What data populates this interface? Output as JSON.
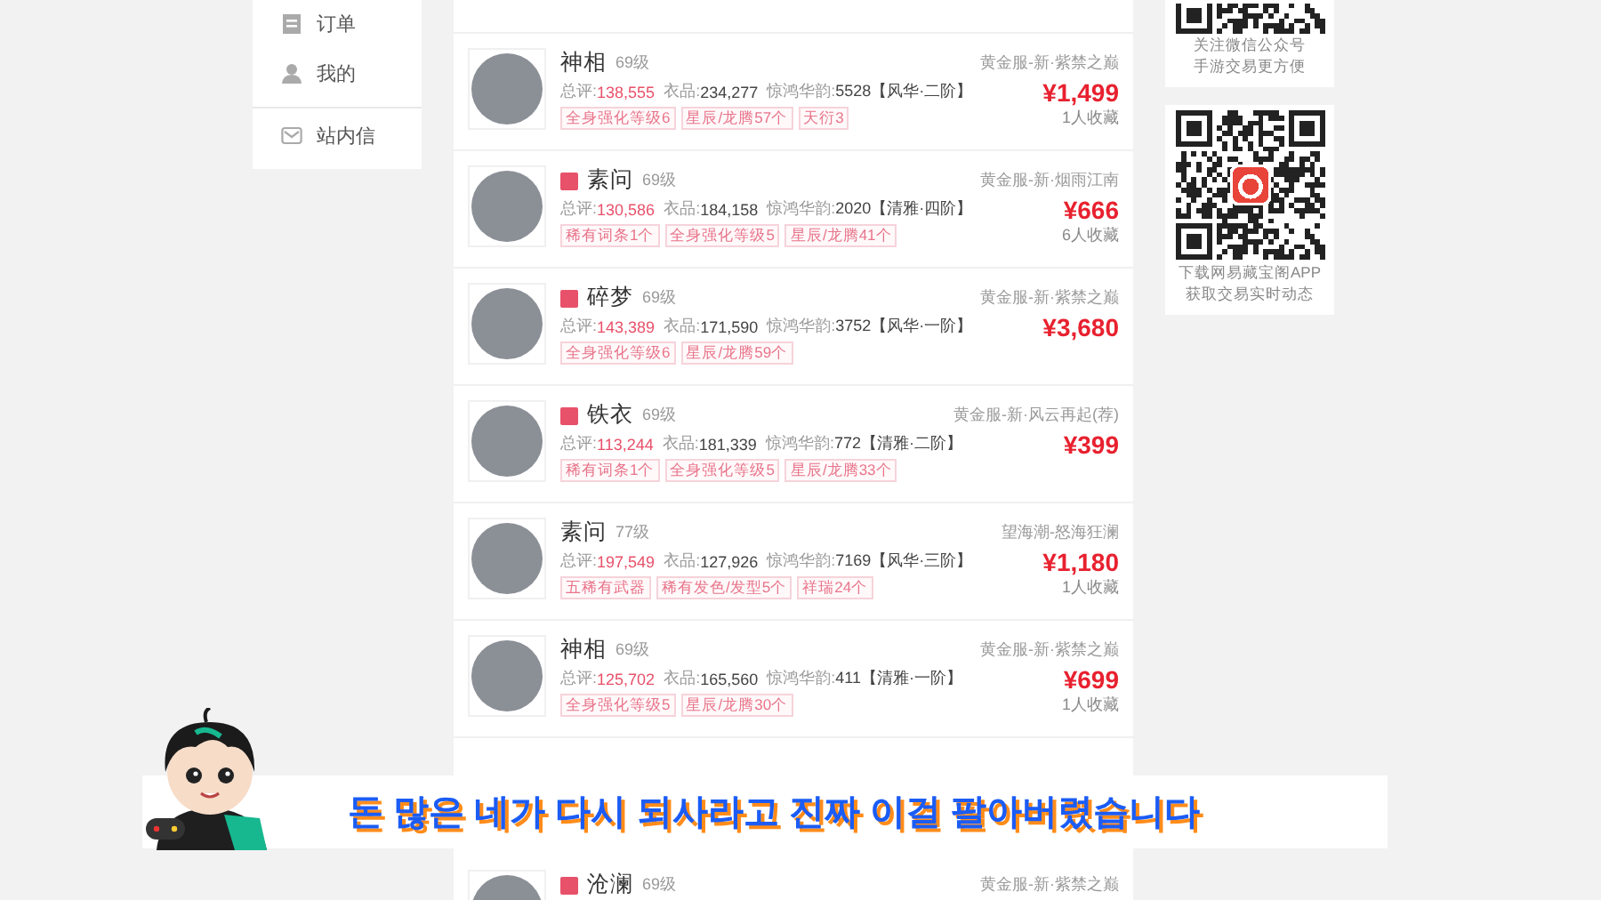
{
  "sidebar": {
    "items": [
      {
        "label": "订单"
      },
      {
        "label": "我的"
      },
      {
        "label": "站内信"
      }
    ]
  },
  "listings": [
    {
      "name": "神相",
      "level": "69级",
      "badge": false,
      "server": "黄金服-新·紫禁之巅",
      "stats": [
        {
          "label": "总评:",
          "value": "138,555"
        },
        {
          "label": "衣品:",
          "value": "234,277"
        },
        {
          "label": "惊鸿华韵:",
          "value": "5528【风华·二阶】"
        }
      ],
      "tags": [
        "全身强化等级6",
        "星辰/龙腾57个",
        "天衍3"
      ],
      "price": "¥1,499",
      "favorites": "1人收藏"
    },
    {
      "name": "素问",
      "level": "69级",
      "badge": true,
      "server": "黄金服-新·烟雨江南",
      "stats": [
        {
          "label": "总评:",
          "value": "130,586"
        },
        {
          "label": "衣品:",
          "value": "184,158"
        },
        {
          "label": "惊鸿华韵:",
          "value": "2020【清雅·四阶】"
        }
      ],
      "tags": [
        "稀有词条1个",
        "全身强化等级5",
        "星辰/龙腾41个"
      ],
      "price": "¥666",
      "favorites": "6人收藏"
    },
    {
      "name": "碎梦",
      "level": "69级",
      "badge": true,
      "server": "黄金服-新·紫禁之巅",
      "stats": [
        {
          "label": "总评:",
          "value": "143,389"
        },
        {
          "label": "衣品:",
          "value": "171,590"
        },
        {
          "label": "惊鸿华韵:",
          "value": "3752【风华·一阶】"
        }
      ],
      "tags": [
        "全身强化等级6",
        "星辰/龙腾59个"
      ],
      "price": "¥3,680"
    },
    {
      "name": "铁衣",
      "level": "69级",
      "badge": true,
      "server": "黄金服-新·风云再起(荐)",
      "stats": [
        {
          "label": "总评:",
          "value": "113,244"
        },
        {
          "label": "衣品:",
          "value": "181,339"
        },
        {
          "label": "惊鸿华韵:",
          "value": "772【清雅·二阶】"
        }
      ],
      "tags": [
        "稀有词条1个",
        "全身强化等级5",
        "星辰/龙腾33个"
      ],
      "price": "¥399"
    },
    {
      "name": "素问",
      "level": "77级",
      "badge": false,
      "server": "望海潮-怒海狂澜",
      "stats": [
        {
          "label": "总评:",
          "value": "197,549"
        },
        {
          "label": "衣品:",
          "value": "127,926"
        },
        {
          "label": "惊鸿华韵:",
          "value": "7169【风华·三阶】"
        }
      ],
      "tags": [
        "五稀有武器",
        "稀有发色/发型5个",
        "祥瑞24个"
      ],
      "price": "¥1,180",
      "favorites": "1人收藏"
    },
    {
      "name": "神相",
      "level": "69级",
      "badge": false,
      "server": "黄金服-新·紫禁之巅",
      "stats": [
        {
          "label": "总评:",
          "value": "125,702"
        },
        {
          "label": "衣品:",
          "value": "165,560"
        },
        {
          "label": "惊鸿华韵:",
          "value": "411【清雅·一阶】"
        }
      ],
      "tags": [
        "全身强化等级5",
        "星辰/龙腾30个"
      ],
      "price": "¥699",
      "favorites": "1人收藏"
    },
    {
      "name": "沧澜",
      "level": "69级",
      "badge": true,
      "server": "黄金服-新·紫禁之巅"
    }
  ],
  "qr_cards": [
    {
      "caption": [
        "关注微信公众号",
        "手游交易更方便"
      ]
    },
    {
      "caption": [
        "下载网易藏宝阁APP",
        "获取交易实时动态"
      ]
    }
  ],
  "subtitle": {
    "text": "돈 많은 네가 다시 되사라고 진짜 이걸 팔아버렸습니다"
  }
}
